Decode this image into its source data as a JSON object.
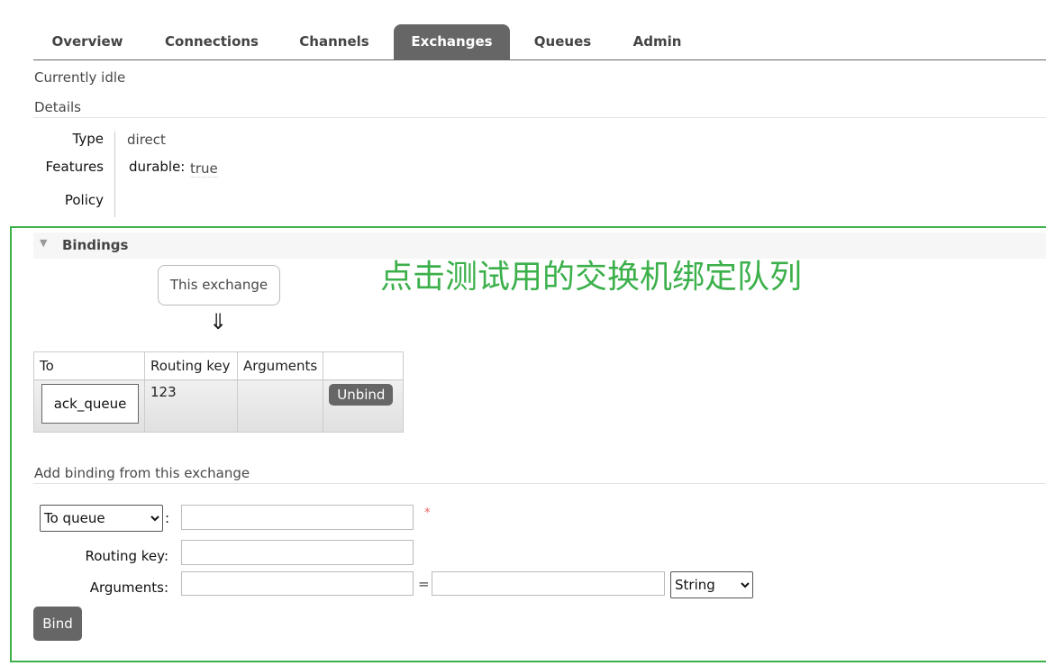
{
  "tabs": [
    {
      "label": "Overview"
    },
    {
      "label": "Connections"
    },
    {
      "label": "Channels"
    },
    {
      "label": "Exchanges"
    },
    {
      "label": "Queues"
    },
    {
      "label": "Admin"
    }
  ],
  "status": "Currently idle",
  "details": {
    "title": "Details",
    "type_label": "Type",
    "type_value": "direct",
    "features_label": "Features",
    "durable_key": "durable:",
    "durable_value": "true",
    "policy_label": "Policy"
  },
  "bindings": {
    "title": "Bindings",
    "source": "This exchange",
    "arrow": "⇓",
    "columns": [
      "To",
      "Routing key",
      "Arguments",
      ""
    ],
    "rows": [
      {
        "to": "ack_queue",
        "routing_key": "123",
        "arguments": "",
        "action": "Unbind"
      }
    ]
  },
  "annotation": {
    "text": "点击测试用的交换机绑定队列",
    "color": "#3cb04b"
  },
  "add_binding": {
    "title": "Add binding from this exchange",
    "destination_type": "To queue",
    "destination_value": "",
    "required_mark": "*",
    "routing_key_label": "Routing key:",
    "routing_key_value": "",
    "arguments_label": "Arguments:",
    "arg_key": "",
    "equals": "=",
    "arg_value": "",
    "arg_type": "String",
    "bind_label": "Bind"
  }
}
